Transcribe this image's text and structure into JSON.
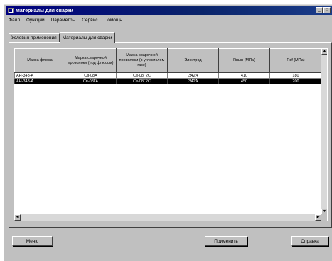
{
  "window": {
    "title": "Материалы для сварки",
    "controls": [
      "_",
      "□"
    ]
  },
  "menu": [
    "Файл",
    "Функции",
    "Параметры",
    "Сервис",
    "Помощь"
  ],
  "tabs": [
    {
      "label": "Условия применения",
      "active": false
    },
    {
      "label": "Материалы для сварки",
      "active": true
    }
  ],
  "table": {
    "columns": [
      "Марка флюса",
      "Марка сварочной проволоки (под флюсом)",
      "Марка сварочной проволоки (в углекислом газе)",
      "Электрод",
      "Rвын (МПа)",
      "Rвf (МПа)"
    ],
    "rows": [
      [
        "АН-348-А",
        "Св-08А",
        "Св-08Г2С",
        "Э42А",
        "410",
        "180"
      ],
      [
        "АН-348-А",
        "Св-08ГА",
        "Св-08Г2С",
        "Э42А",
        "450",
        "200"
      ]
    ],
    "selected_row": 1
  },
  "buttons": {
    "menu": "Меню",
    "apply": "Применить",
    "help": "Справка"
  }
}
